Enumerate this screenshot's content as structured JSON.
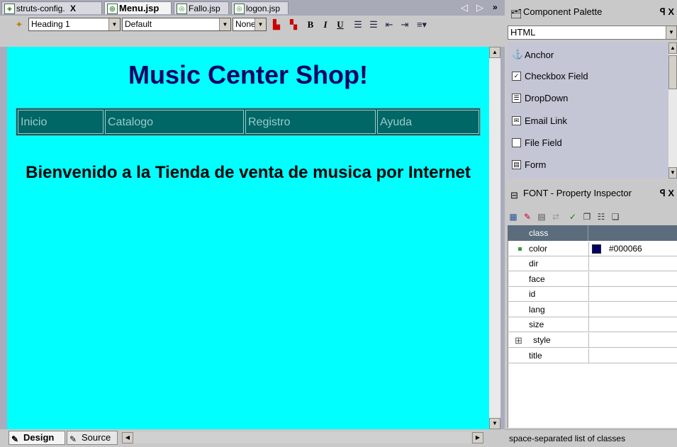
{
  "editor": {
    "tabs": [
      {
        "label": "struts-config.",
        "close": "X"
      },
      {
        "label": "Menu.jsp"
      },
      {
        "label": "Fallo.jsp"
      },
      {
        "label": "logon.jsp"
      }
    ],
    "nav": {
      "prev": "◁",
      "next": "▷",
      "more": "»"
    }
  },
  "format_toolbar": {
    "block_format": "Heading 1",
    "font": "Default",
    "size": "None",
    "bold": "B",
    "italic": "I",
    "underline": "U"
  },
  "page": {
    "title": "Music Center Shop!",
    "nav_links": [
      "Inicio",
      "Catalogo",
      "Registro",
      "Ayuda"
    ],
    "welcome": "Bienvenido a la Tienda de venta de musica por Internet"
  },
  "bottom_tabs": [
    {
      "label": "Design"
    },
    {
      "label": "Source"
    }
  ],
  "component_palette": {
    "title": "Component Palette",
    "category": "HTML",
    "items": [
      "Anchor",
      "Checkbox Field",
      "DropDown",
      "Email Link",
      "File Field",
      "Form"
    ]
  },
  "property_inspector": {
    "title": "FONT - Property Inspector",
    "header": "class",
    "rows": [
      {
        "name": "color",
        "value": "#000066"
      },
      {
        "name": "dir",
        "value": ""
      },
      {
        "name": "face",
        "value": ""
      },
      {
        "name": "id",
        "value": ""
      },
      {
        "name": "lang",
        "value": ""
      },
      {
        "name": "size",
        "value": ""
      },
      {
        "name": "style",
        "value": ""
      },
      {
        "name": "title",
        "value": ""
      }
    ],
    "expand_symbol": "⊞",
    "status": "space-separated list of classes"
  },
  "panel_controls": {
    "pin": "ꟼ",
    "close": "X"
  },
  "colors": {
    "canvas": "#00ffff",
    "title_color": "#000066",
    "nav_bg": "#006666",
    "nav_text": "#99cccc",
    "grid_header": "#5b6c7d"
  }
}
